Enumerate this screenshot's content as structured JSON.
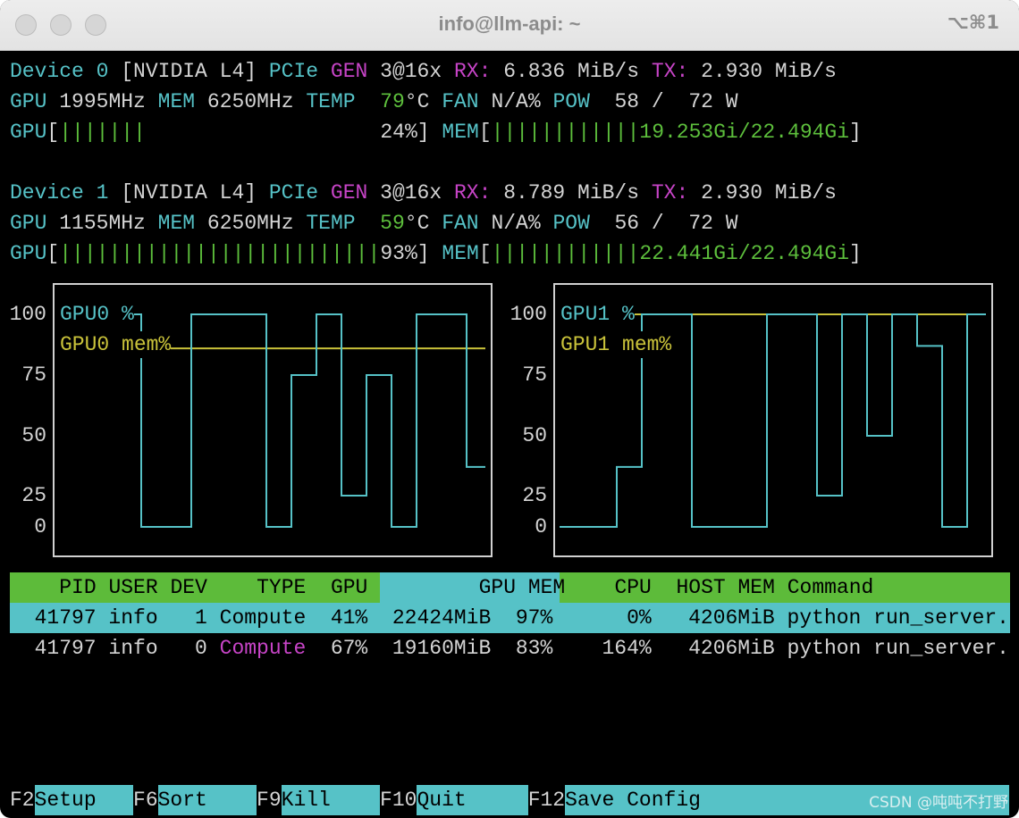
{
  "window": {
    "title": "info@llm-api: ~",
    "shortcut": "⌥⌘1"
  },
  "colors": {
    "cyan": "#56c2c7",
    "magenta": "#c744c7",
    "green": "#5dbf3c",
    "yellow": "#c9c23a",
    "text": "#d4d4d4"
  },
  "devices": [
    {
      "label": "Device 0",
      "name": "[NVIDIA L4]",
      "pcie": "PCIe",
      "gen": "GEN",
      "gen_value": "3@16x",
      "rx_label": "RX:",
      "rx": "6.836 MiB/s",
      "tx_label": "TX:",
      "tx": "2.930 MiB/s",
      "gpu_label": "GPU",
      "gpu_clock": "1995MHz",
      "mem_label": "MEM",
      "mem_clock": "6250MHz",
      "temp_label": "TEMP",
      "temp": "79",
      "temp_unit": "°C",
      "fan_label": "FAN",
      "fan": "N/A%",
      "pow_label": "POW",
      "pow": "58 /  72 W",
      "gpu_util": 24,
      "gpu_util_text": "24%",
      "mem_used_fraction": 0.856,
      "mem_text": "19.253Gi/22.494Gi"
    },
    {
      "label": "Device 1",
      "name": "[NVIDIA L4]",
      "pcie": "PCIe",
      "gen": "GEN",
      "gen_value": "3@16x",
      "rx_label": "RX:",
      "rx": "8.789 MiB/s",
      "tx_label": "TX:",
      "tx": "2.930 MiB/s",
      "gpu_label": "GPU",
      "gpu_clock": "1155MHz",
      "mem_label": "MEM",
      "mem_clock": "6250MHz",
      "temp_label": "TEMP",
      "temp": "59",
      "temp_unit": "°C",
      "fan_label": "FAN",
      "fan": "N/A%",
      "pow_label": "POW",
      "pow": "56 /  72 W",
      "gpu_util": 93,
      "gpu_util_text": "93%",
      "mem_used_fraction": 0.998,
      "mem_text": "22.441Gi/22.494Gi"
    }
  ],
  "chart_data": [
    {
      "type": "line",
      "step": true,
      "yticks": [
        "100",
        "75",
        "50",
        "25",
        "0"
      ],
      "ylim": [
        0,
        100
      ],
      "grid": false,
      "legend_placement": "top-left",
      "series": [
        {
          "name": "GPU0 %",
          "color": "#56c2c7",
          "values": [
            100,
            0,
            0,
            100,
            100,
            100,
            0,
            75,
            100,
            25,
            75,
            0,
            100,
            100,
            37
          ]
        },
        {
          "name": "GPU0 mem%",
          "color": "#c9c23a",
          "values": [
            86,
            86,
            86,
            86,
            86,
            86,
            86,
            86,
            86,
            86,
            86,
            86,
            86
          ]
        }
      ]
    },
    {
      "type": "line",
      "step": true,
      "yticks": [
        "100",
        "75",
        "50",
        "25",
        "0"
      ],
      "ylim": [
        0,
        100
      ],
      "grid": false,
      "legend_placement": "top-left",
      "series": [
        {
          "name": "GPU1 %",
          "color": "#56c2c7",
          "values": [
            0,
            0,
            0,
            37,
            100,
            100,
            0,
            0,
            0,
            100,
            100,
            25,
            100,
            50,
            100,
            87,
            0,
            100
          ]
        },
        {
          "name": "GPU1 mem%",
          "color": "#c9c23a",
          "values": [
            100,
            100,
            100,
            100,
            100,
            100,
            100,
            100,
            100,
            100,
            100,
            100,
            100,
            100,
            100
          ]
        }
      ]
    }
  ],
  "table": {
    "headers": {
      "pid": "PID",
      "user": "USER",
      "dev": "DEV",
      "type": "TYPE",
      "gpu": "GPU",
      "gpu_mem": "GPU MEM",
      "cpu": "CPU",
      "host_mem": "HOST MEM",
      "command": "Command"
    },
    "sorted_column": "GPU MEM",
    "rows": [
      {
        "pid": "41797",
        "user": "info",
        "dev": "1",
        "type": "Compute",
        "gpu": "41%",
        "gpu_mem": "22424MiB",
        "gpu_mem_pct": "97%",
        "cpu": "0%",
        "host_mem": "4206MiB",
        "command": "python run_server.",
        "selected": true
      },
      {
        "pid": "41797",
        "user": "info",
        "dev": "0",
        "type": "Compute",
        "gpu": "67%",
        "gpu_mem": "19160MiB",
        "gpu_mem_pct": "83%",
        "cpu": "164%",
        "host_mem": "4206MiB",
        "command": "python run_server.",
        "selected": false
      }
    ]
  },
  "footer": [
    {
      "key": "F2",
      "label": "Setup"
    },
    {
      "key": "F6",
      "label": "Sort"
    },
    {
      "key": "F9",
      "label": "Kill"
    },
    {
      "key": "F10",
      "label": "Quit"
    },
    {
      "key": "F12",
      "label": "Save Config"
    }
  ],
  "watermark": "CSDN @吨吨不打野"
}
